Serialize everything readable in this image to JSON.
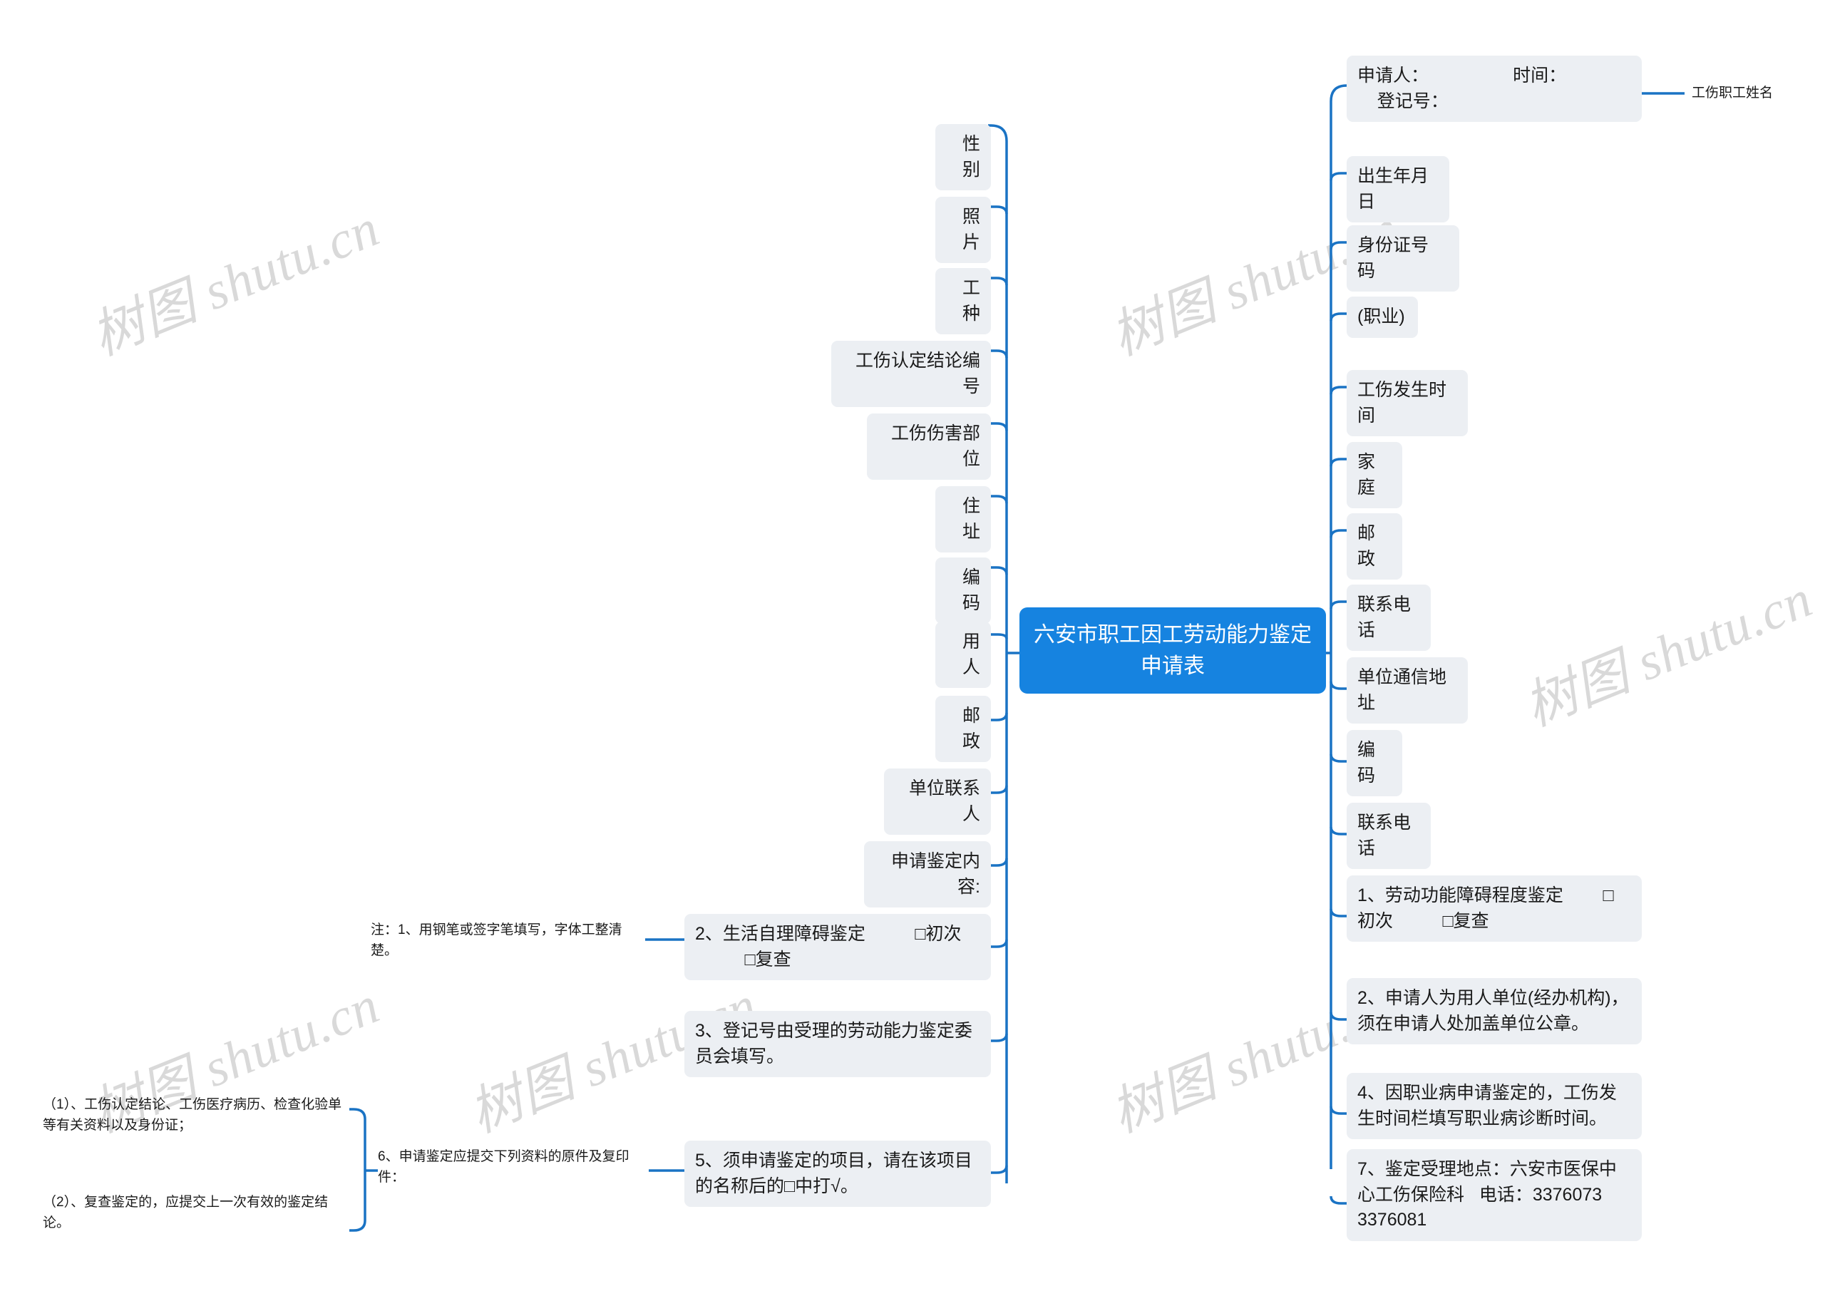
{
  "colors": {
    "accent": "#1683e0",
    "link": "#1a73c4",
    "node_bg": "#eceff3",
    "node_text": "#1a1a1a",
    "center_text": "#ffffff",
    "watermark": "#d9d9d9",
    "page_bg": "#ffffff"
  },
  "watermark": {
    "text": "树图 shutu.cn",
    "instances": 6
  },
  "mindmap": {
    "root": {
      "label": "六安市职工因工劳动能力鉴定申请表"
    },
    "right_branch": [
      {
        "label": "申请人：                 时间：\n    登记号：",
        "child": "工伤职工姓名"
      },
      {
        "label": "出生年月日"
      },
      {
        "label": "身份证号 码"
      },
      {
        "label": "(职业)"
      },
      {
        "label": "工伤发生时间"
      },
      {
        "label": "家庭"
      },
      {
        "label": "邮政"
      },
      {
        "label": "联系电话"
      },
      {
        "label": "单位通信地址"
      },
      {
        "label": "编码"
      },
      {
        "label": "联系电话"
      },
      {
        "label": "1、劳动功能障碍程度鉴定        □初次          □复查"
      },
      {
        "label": "2、申请人为用人单位(经办机构)，须在申请人处加盖单位公章。"
      },
      {
        "label": "4、因职业病申请鉴定的，工伤发生时间栏填写职业病诊断时间。"
      },
      {
        "label": "7、鉴定受理地点：六安市医保中心工伤保险科   电话：3376073 3376081"
      }
    ],
    "left_branch": [
      {
        "label": "性别"
      },
      {
        "label": "照片"
      },
      {
        "label": "工种"
      },
      {
        "label": "工伤认定结论编号"
      },
      {
        "label": "工伤伤害部位"
      },
      {
        "label": "住址"
      },
      {
        "label": "编码"
      },
      {
        "label": "用人"
      },
      {
        "label": "邮政"
      },
      {
        "label": "单位联系人"
      },
      {
        "label": "申请鉴定内容:"
      },
      {
        "label": "2、生活自理障碍鉴定          □初次\n          □复查",
        "note": "注：1、用钢笔或签字笔填写，字体工整清楚。"
      },
      {
        "label": "3、登记号由受理的劳动能力鉴定委员会填写。"
      },
      {
        "label": "5、须申请鉴定的项目，请在该项目的名称后的□中打√。",
        "note": "6、申请鉴定应提交下列资料的原件及复印件："
      }
    ],
    "far_left_notes": [
      {
        "label": "（1）、工伤认定结论、工伤医疗病历、检查化验单等有关资料以及身份证；"
      },
      {
        "label": "（2）、复查鉴定的，应提交上一次有效的鉴定结论。"
      }
    ]
  }
}
